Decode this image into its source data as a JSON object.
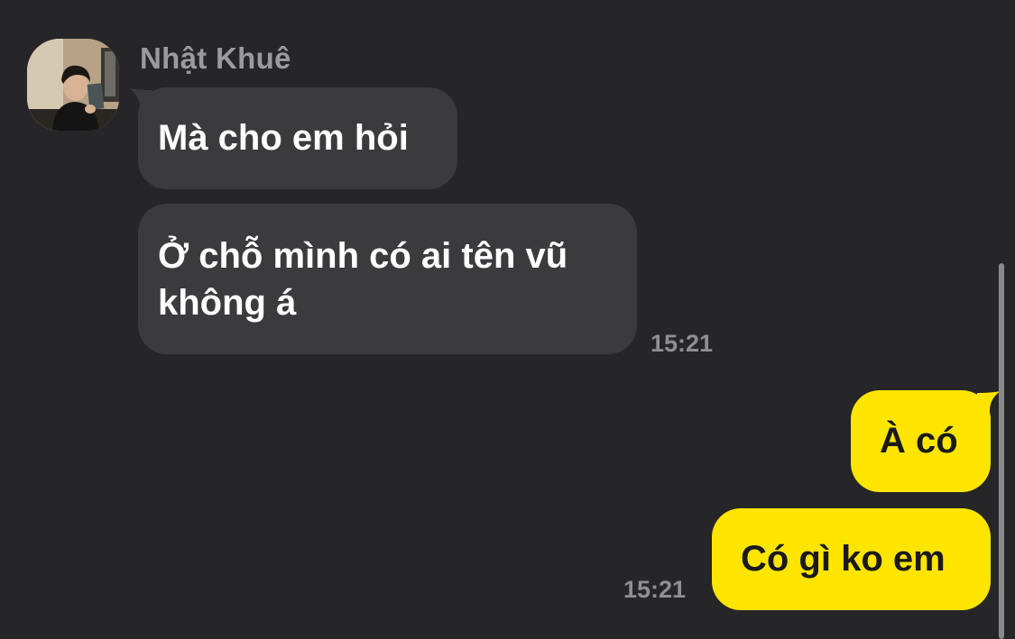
{
  "conversation": {
    "sender_name": "Nhật Khuê",
    "incoming": [
      {
        "lines": [
          "Mà cho em hỏi"
        ]
      },
      {
        "lines": [
          "Ở chỗ mình có ai tên vũ",
          "không á"
        ]
      }
    ],
    "incoming_time": "15:21",
    "outgoing": [
      {
        "lines": [
          "À có"
        ]
      },
      {
        "lines": [
          "Có gì ko em"
        ]
      }
    ],
    "outgoing_time": "15:21"
  },
  "colors": {
    "background": "#262628",
    "incoming_bubble": "#3b3b3e",
    "outgoing_bubble": "#fee500",
    "sender_name": "#9b9b9f",
    "timestamp": "#8e8e93"
  }
}
